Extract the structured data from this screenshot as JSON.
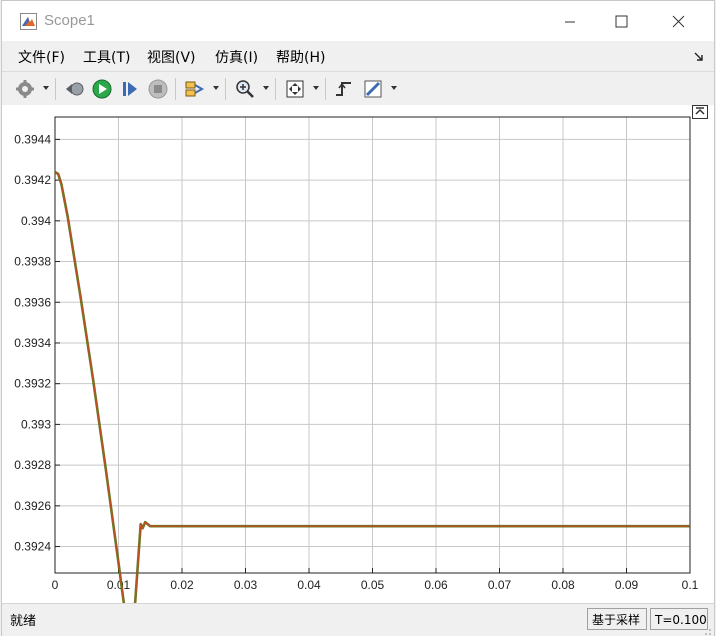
{
  "window": {
    "title": "Scope1"
  },
  "menu": {
    "file": "文件(F)",
    "tools": "工具(T)",
    "view": "视图(V)",
    "simulation": "仿真(I)",
    "help": "帮助(H)"
  },
  "toolbar": {
    "icons": [
      "gear-icon",
      "rewind-icon",
      "run-icon",
      "step-forward-icon",
      "stop-icon",
      "signal-select-icon",
      "zoom-icon",
      "autoscale-icon",
      "trigger-icon",
      "measure-icon"
    ]
  },
  "colors": {
    "trace": "#c0501f",
    "trace_shadow": "#4a6a10",
    "grid": "#c8c8c8",
    "run_green": "#2ba84a",
    "accent_blue": "#3d6bb3"
  },
  "status": {
    "text": "就绪",
    "mode": "基于采样",
    "time": "T=0.100"
  },
  "chart_data": {
    "type": "line",
    "xlim": [
      0,
      0.1
    ],
    "ylim": [
      0.39227,
      0.39451
    ],
    "x_ticks": [
      0,
      0.01,
      0.02,
      0.03,
      0.04,
      0.05,
      0.06,
      0.07,
      0.08,
      0.09,
      0.1
    ],
    "x_tick_labels": [
      "0",
      "0.01",
      "0.02",
      "0.03",
      "0.04",
      "0.05",
      "0.06",
      "0.07",
      "0.08",
      "0.09",
      "0.1"
    ],
    "y_ticks": [
      0.3924,
      0.3926,
      0.3928,
      0.393,
      0.3932,
      0.3934,
      0.3936,
      0.3938,
      0.394,
      0.3942,
      0.3944
    ],
    "y_tick_labels": [
      "0.3924",
      "0.3926",
      "0.3928",
      "0.393",
      "0.3932",
      "0.3934",
      "0.3936",
      "0.3938",
      "0.394",
      "0.3942",
      "0.3944"
    ],
    "grid": true,
    "series": [
      {
        "x": [
          0,
          0.0005,
          0.001,
          0.002,
          0.004,
          0.006,
          0.008,
          0.01,
          0.012,
          0.0135,
          0.0138,
          0.0142,
          0.0146,
          0.015,
          0.016,
          0.02,
          0.03,
          0.05,
          0.07,
          0.09,
          0.1
        ],
        "y": [
          0.39424,
          0.39423,
          0.39418,
          0.39402,
          0.39363,
          0.39322,
          0.39278,
          0.39232,
          0.39185,
          0.39251,
          0.39249,
          0.39252,
          0.39251,
          0.3925,
          0.3925,
          0.3925,
          0.3925,
          0.3925,
          0.3925,
          0.3925,
          0.3925
        ]
      }
    ]
  }
}
